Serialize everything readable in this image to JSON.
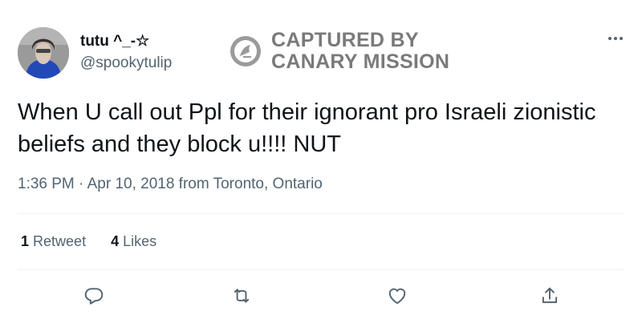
{
  "user": {
    "display_name": "tutu ^_-☆",
    "handle": "@spookytulip"
  },
  "watermark": {
    "line1": "CAPTURED BY",
    "line2": "CANARY MISSION"
  },
  "tweet": {
    "text": "When U call out Ppl for their ignorant pro Israeli zionistic beliefs and they block u!!!! NUT",
    "meta": "1:36 PM · Apr 10, 2018 from Toronto, Ontario"
  },
  "stats": {
    "retweets_count": "1",
    "retweets_label": "Retweet",
    "likes_count": "4",
    "likes_label": "Likes"
  },
  "icons": {
    "more": "more-dots-icon",
    "reply": "reply-icon",
    "retweet": "retweet-icon",
    "like": "heart-icon",
    "share": "share-icon",
    "watermark": "canary-bird-icon"
  },
  "colors": {
    "text_primary": "#0f1419",
    "text_secondary": "#536471",
    "watermark": "#7a7a7a",
    "divider": "#eff3f4"
  }
}
